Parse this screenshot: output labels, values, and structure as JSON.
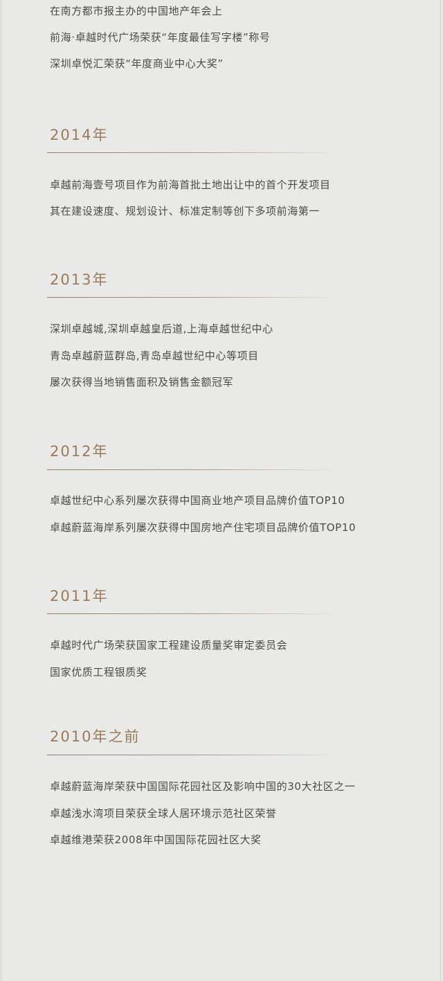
{
  "intro_lines": [
    "在南方都市报主办的中国地产年会上",
    "前海·卓越时代广场荣获“年度最佳写字楼”称号",
    "深圳卓悦汇荣获“年度商业中心大奖”"
  ],
  "sections": [
    {
      "year": "2014年",
      "lines": [
        "卓越前海壹号项目作为前海首批土地出让中的首个开发项目",
        "其在建设速度、规划设计、标准定制等创下多项前海第一"
      ]
    },
    {
      "year": "2013年",
      "lines": [
        "深圳卓越城,深圳卓越皇后道,上海卓越世纪中心",
        "青岛卓越蔚蓝群岛,青岛卓越世纪中心等项目",
        "屡次获得当地销售面积及销售金额冠军"
      ]
    },
    {
      "year": "2012年",
      "lines": [
        "卓越世纪中心系列屡次获得中国商业地产项目品牌价值TOP10",
        "卓越蔚蓝海岸系列屡次获得中国房地产住宅项目品牌价值TOP10"
      ]
    },
    {
      "year": "2011年",
      "lines": [
        "卓越时代广场荣获国家工程建设质量奖审定委员会",
        "国家优质工程银质奖"
      ]
    },
    {
      "year": "2010年之前",
      "lines": [
        "卓越蔚蓝海岸荣获中国国际花园社区及影响中国的30大社区之一",
        "卓越浅水湾项目荣获全球人居环境示范社区荣誉",
        "卓越维港荣获2008年中国国际花园社区大奖"
      ]
    }
  ],
  "colors": {
    "background": "#e9e9e8",
    "heading": "#9a7a5d",
    "body_text": "#4a4a4a",
    "rule": "#8a7c6e"
  }
}
